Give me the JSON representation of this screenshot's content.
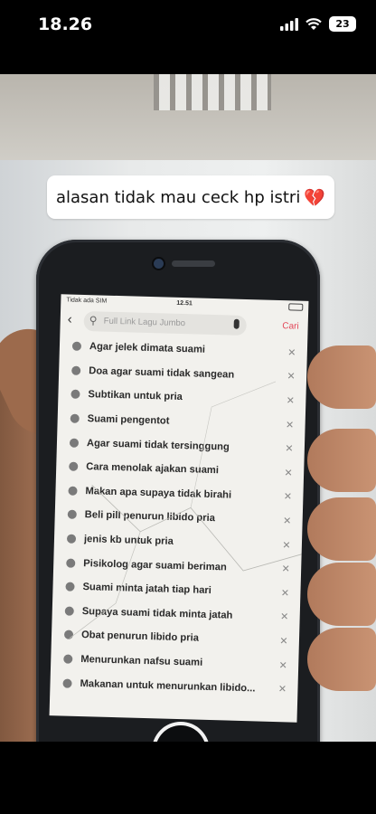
{
  "status": {
    "time": "18.26",
    "battery": "23"
  },
  "caption": {
    "text": "alasan tidak mau ceck hp istri",
    "emoji": "💔"
  },
  "phone_screen": {
    "status": {
      "carrier": "Tidak ada SIM",
      "time": "12.51"
    },
    "search": {
      "placeholder": "Full Link Lagu Jumbo",
      "button": "Cari"
    },
    "history": [
      "Agar jelek dimata suami",
      "Doa agar suami tidak sangean",
      "Subtikan untuk pria",
      "Suami pengentot",
      "Agar suami tidak tersinggung",
      "Cara menolak ajakan suami",
      "Makan apa supaya tidak birahi",
      "Beli pill penurun libido pria",
      "jenis kb untuk pria",
      "Pisikolog agar suami beriman",
      "Suami minta jatah tiap hari",
      "Supaya suami tidak minta jatah",
      "Obat penurun libido pria",
      "Menurunkan nafsu suami",
      "Makanan untuk menurunkan libido..."
    ]
  },
  "colors": {
    "accent": "#e24456",
    "caption_bg": "#ffffff",
    "screen_bg": "#f2f1ed"
  }
}
